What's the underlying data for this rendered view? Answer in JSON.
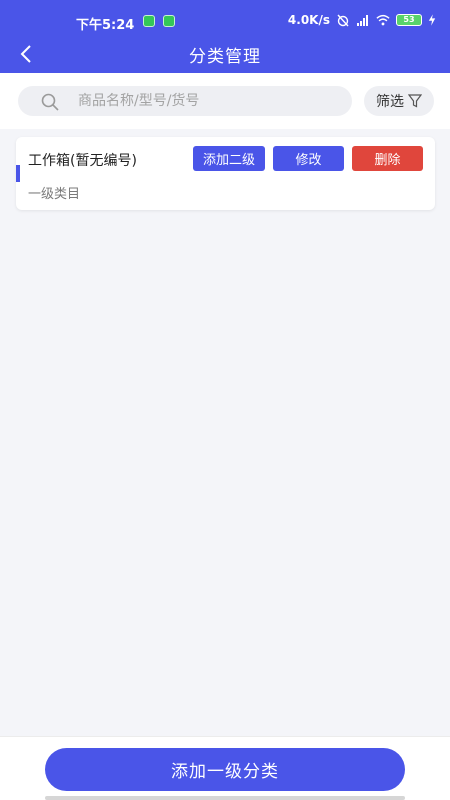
{
  "status_bar": {
    "time": "下午5:24",
    "network_speed": "4.0K/s",
    "battery": "53"
  },
  "header": {
    "title": "分类管理",
    "back_icon": "chevron-left-icon"
  },
  "search": {
    "placeholder": "商品名称/型号/货号",
    "value": ""
  },
  "filter": {
    "label": "筛选"
  },
  "categories": [
    {
      "name": "工作箱(暂无编号)",
      "level": "一级类目",
      "actions": {
        "add_child": "添加二级",
        "edit": "修改",
        "delete": "删除"
      }
    }
  ],
  "footer": {
    "add_top_level": "添加一级分类"
  },
  "colors": {
    "primary": "#4a55e8",
    "danger": "#e0463c",
    "background": "#f4f5f9"
  }
}
